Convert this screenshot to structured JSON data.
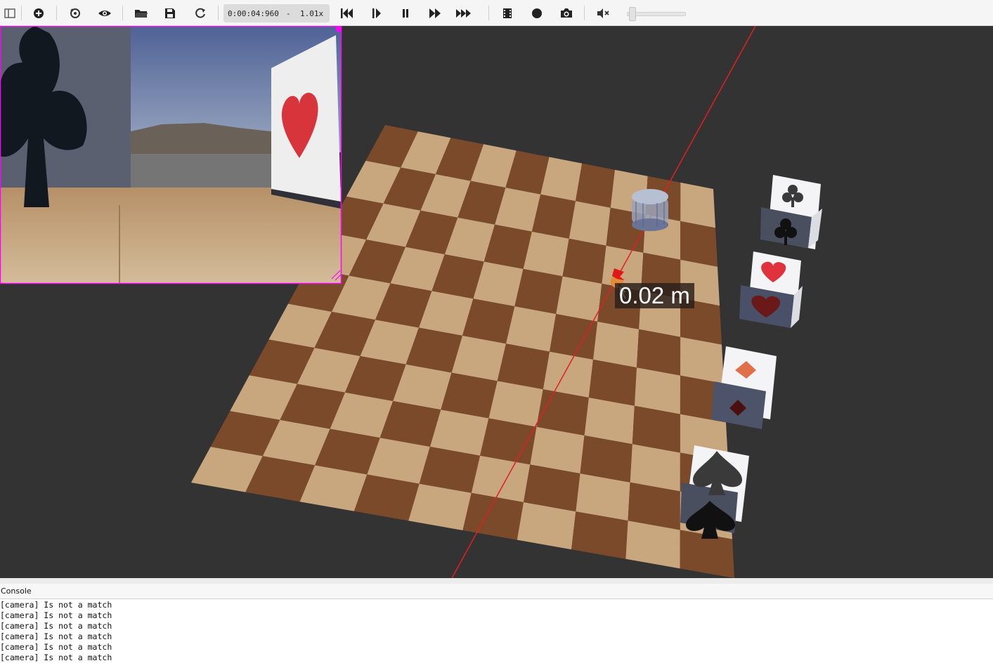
{
  "toolbar": {
    "time": "0:00:04:960",
    "time_separator": "-",
    "speed": "1.01x",
    "volume_level": 0.05,
    "icons": [
      "toggle-panel-icon",
      "add-node-icon",
      "reset-view-icon",
      "eye-icon",
      "open-folder-icon",
      "save-icon",
      "reload-icon",
      "step-back-icon",
      "step-forward-icon",
      "pause-icon",
      "fast-forward-icon",
      "fastest-icon",
      "film-icon",
      "record-icon",
      "camera-icon",
      "mute-icon"
    ]
  },
  "viewport": {
    "measurement": "0.02 m",
    "colors": {
      "background": "#333333",
      "light_square": "#c9a77e",
      "dark_square": "#7a4a2b",
      "axis": "#e02020",
      "overlay_border": "#ff00ff"
    },
    "cards": [
      "club",
      "heart",
      "diamond",
      "spade"
    ]
  },
  "console": {
    "title": "Console",
    "lines": [
      "[camera] Is not a match",
      "[camera] Is not a match",
      "[camera] Is not a match",
      "[camera] Is not a match",
      "[camera] Is not a match",
      "[camera] Is not a match"
    ]
  }
}
